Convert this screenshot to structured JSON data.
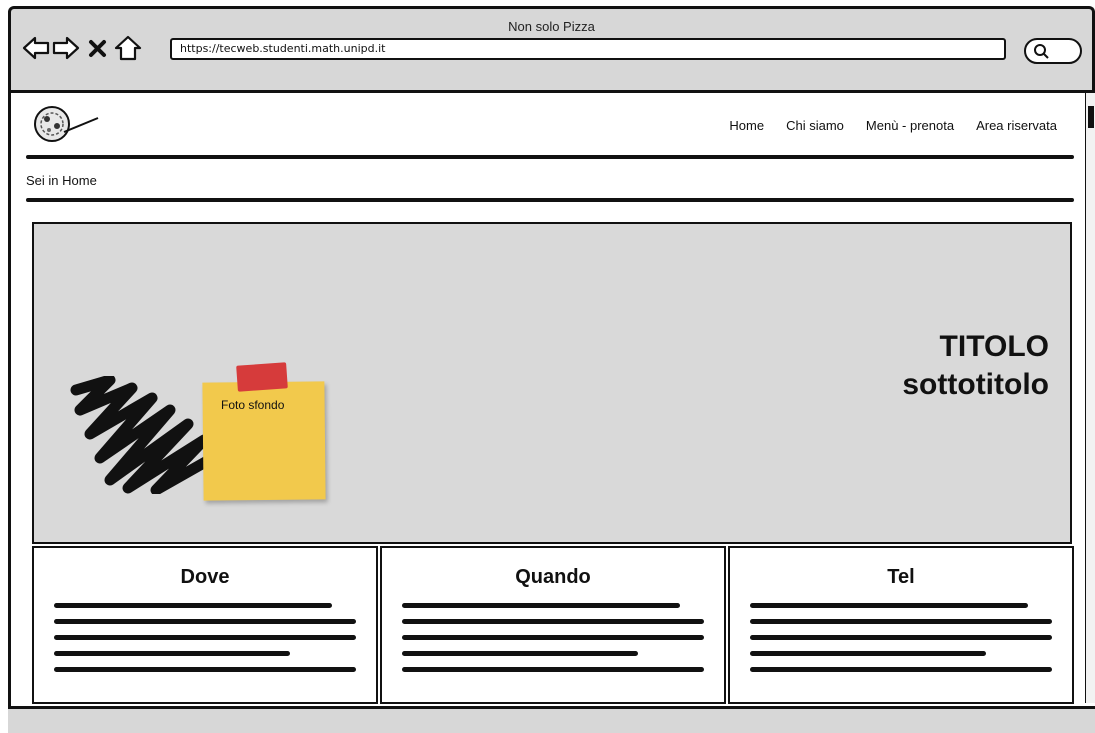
{
  "browser": {
    "window_title": "Non solo Pizza",
    "url": "https://tecweb.studenti.math.unipd.it"
  },
  "site": {
    "nav": [
      "Home",
      "Chi siamo",
      "Menù - prenota",
      "Area riservata"
    ],
    "breadcrumb": "Sei in Home"
  },
  "hero": {
    "title": "TITOLO",
    "subtitle": "sottotitolo",
    "sticky_note": "Foto sfondo"
  },
  "boxes": [
    {
      "title": "Dove"
    },
    {
      "title": "Quando"
    },
    {
      "title": "Tel"
    }
  ],
  "icons": [
    "back-arrow-icon",
    "forward-arrow-icon",
    "close-icon",
    "home-icon",
    "search-icon",
    "logo-icon"
  ],
  "colors": {
    "chrome": "#d7d7d7",
    "hero": "#d9d9d9",
    "sticky": "#f2c94c",
    "tape": "#d63b3b"
  }
}
